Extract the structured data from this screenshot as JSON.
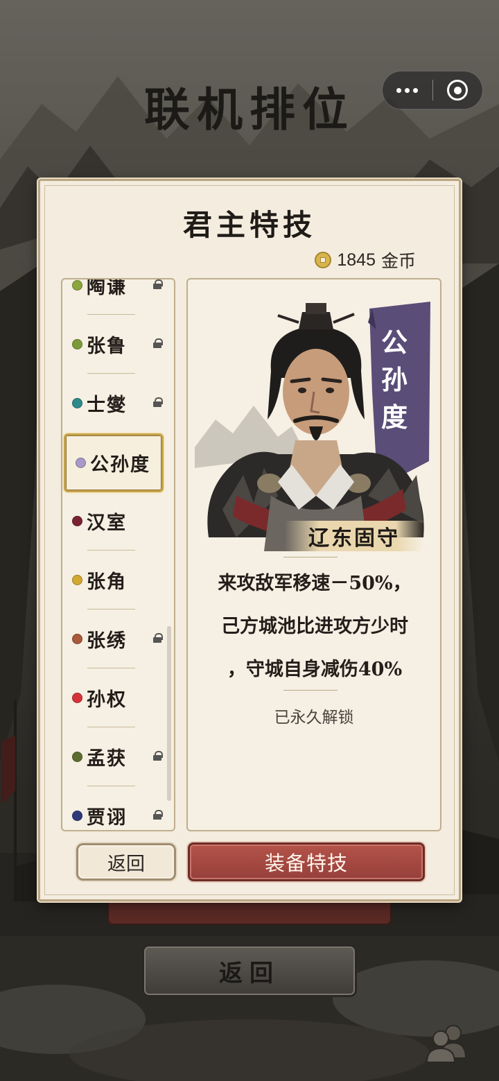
{
  "header": {
    "title": "联机排位"
  },
  "panel": {
    "title": "君主特技",
    "coins_value": "1845",
    "coins_unit": "金币"
  },
  "lords": [
    {
      "name": "陶谦",
      "color": "#8aa63c",
      "locked": true
    },
    {
      "name": "张鲁",
      "color": "#7b9a3a",
      "locked": true
    },
    {
      "name": "士燮",
      "color": "#2f8a8c",
      "locked": true
    },
    {
      "name": "公孙度",
      "color": "#a79ac8",
      "locked": false,
      "selected": true
    },
    {
      "name": "汉室",
      "color": "#7a2233",
      "locked": false
    },
    {
      "name": "张角",
      "color": "#d3a830",
      "locked": false
    },
    {
      "name": "张绣",
      "color": "#a85a3a",
      "locked": true
    },
    {
      "name": "孙权",
      "color": "#d6323a",
      "locked": false
    },
    {
      "name": "孟获",
      "color": "#5c6e2e",
      "locked": true
    },
    {
      "name": "贾诩",
      "color": "#2d3a7a",
      "locked": true
    }
  ],
  "detail": {
    "portrait_name_chars": [
      "公",
      "孙",
      "度"
    ],
    "skill_title": "辽东固守",
    "description_lines": [
      "来攻敌军移速－50%，",
      "己方城池比进攻方少时",
      "，守城自身减伤40%"
    ],
    "unlock_status": "已永久解锁"
  },
  "buttons": {
    "back": "返回",
    "equip": "装备特技",
    "bottom_back": "返回"
  },
  "colors": {
    "accent_red": "#a84a43",
    "gold_border": "#c6a24a",
    "name_banner": "#5a4d78"
  }
}
